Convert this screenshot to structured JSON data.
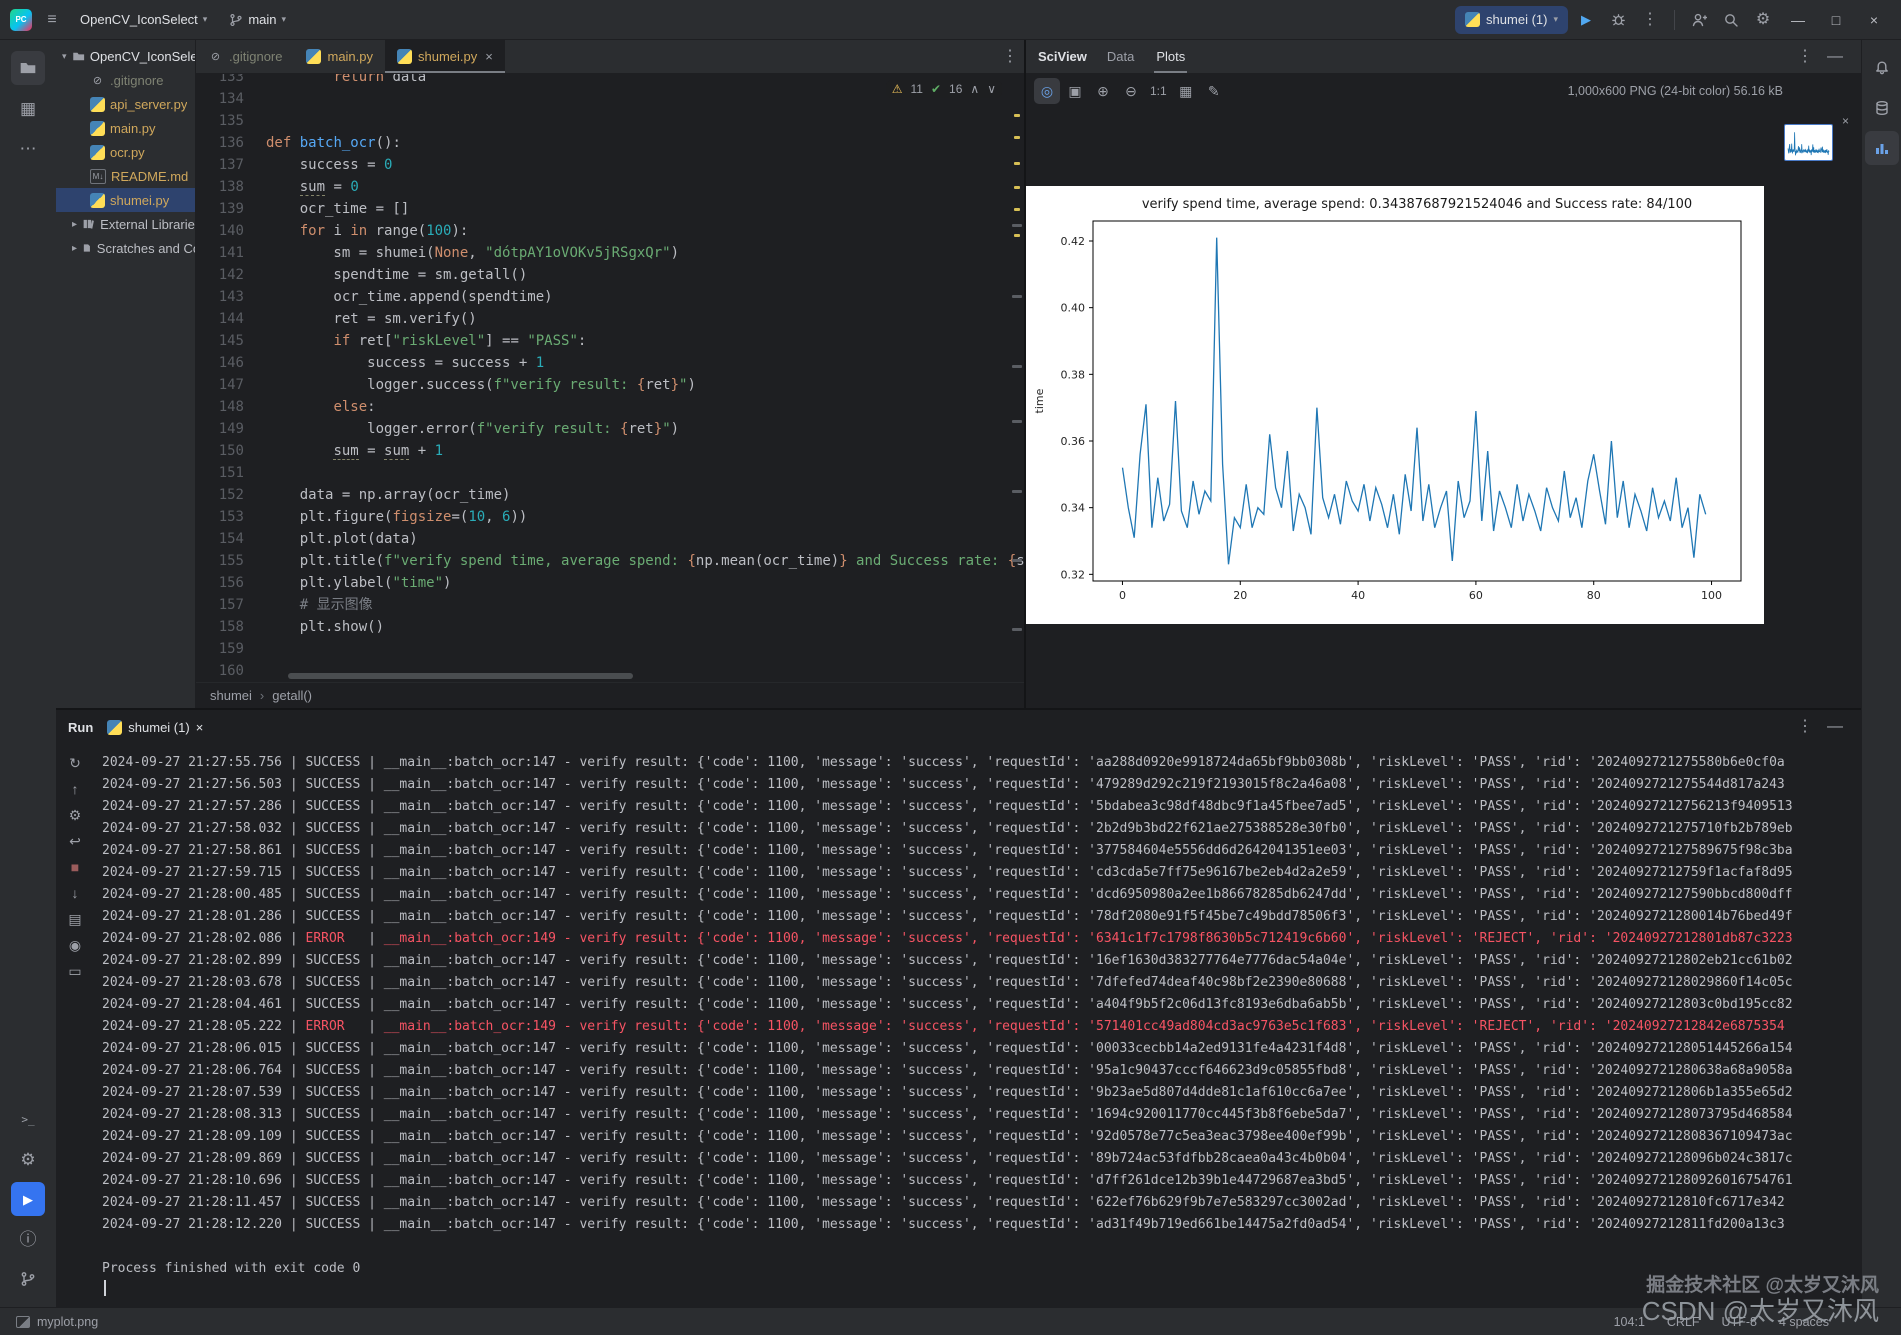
{
  "titlebar": {
    "app_logo": "PC",
    "project": "OpenCV_IconSelect",
    "branch": "main",
    "run_config": "shumei (1)",
    "window_controls": {
      "min": "—",
      "max": "□",
      "close": "×"
    }
  },
  "project": {
    "root": "OpenCV_IconSelect",
    "files": [
      {
        "icon": "ignored",
        "label": ".gitignore",
        "style": "ignored"
      },
      {
        "icon": "python",
        "label": "api_server.py",
        "style": "vcs"
      },
      {
        "icon": "python",
        "label": "main.py",
        "style": "vcs"
      },
      {
        "icon": "python",
        "label": "ocr.py",
        "style": "vcs"
      },
      {
        "icon": "markdown",
        "label": "README.md",
        "style": "vcs"
      },
      {
        "icon": "python",
        "label": "shumei.py",
        "style": "vcs",
        "selected": true
      }
    ],
    "groups": [
      {
        "label": "External Libraries"
      },
      {
        "label": "Scratches and Consoles"
      }
    ]
  },
  "editor": {
    "tabs": [
      {
        "label": ".gitignore"
      },
      {
        "label": "main.py"
      },
      {
        "label": "shumei.py",
        "close": "×"
      }
    ],
    "inspections": {
      "warnings": "11",
      "passed": "16"
    },
    "breadcrumb": [
      "shumei",
      "getall()"
    ],
    "lines": [
      {
        "no": "133",
        "t": [
          [
            "p",
            "        "
          ],
          [
            "k",
            "return"
          ],
          [
            "p",
            " data"
          ]
        ]
      },
      {
        "no": "134",
        "t": []
      },
      {
        "no": "135",
        "t": []
      },
      {
        "no": "136",
        "t": [
          [
            "k",
            "def"
          ],
          [
            "p",
            " "
          ],
          [
            "d",
            "batch_ocr"
          ],
          [
            "p",
            "():"
          ]
        ]
      },
      {
        "no": "137",
        "t": [
          [
            "p",
            "    success = "
          ],
          [
            "n",
            "0"
          ]
        ]
      },
      {
        "no": "138",
        "t": [
          [
            "p",
            "    "
          ],
          [
            "w",
            "sum"
          ],
          [
            "p",
            " = "
          ],
          [
            "n",
            "0"
          ]
        ]
      },
      {
        "no": "139",
        "t": [
          [
            "p",
            "    ocr_time = []"
          ]
        ]
      },
      {
        "no": "140",
        "t": [
          [
            "p",
            "    "
          ],
          [
            "k",
            "for"
          ],
          [
            "p",
            " i "
          ],
          [
            "k",
            "in"
          ],
          [
            "p",
            " "
          ],
          [
            "b",
            "range"
          ],
          [
            "p",
            "("
          ],
          [
            "n",
            "100"
          ],
          [
            "p",
            "):"
          ]
        ]
      },
      {
        "no": "141",
        "t": [
          [
            "p",
            "        sm = shumei("
          ],
          [
            "k",
            "None"
          ],
          [
            "p",
            ", "
          ],
          [
            "s",
            "\"dótpAY1oVOKv5jRSgxQr\""
          ],
          [
            "p",
            ")"
          ]
        ]
      },
      {
        "no": "142",
        "t": [
          [
            "p",
            "        spendtime = sm.getall()"
          ]
        ]
      },
      {
        "no": "143",
        "t": [
          [
            "p",
            "        ocr_time.append(spendtime)"
          ]
        ]
      },
      {
        "no": "144",
        "t": [
          [
            "p",
            "        ret = sm.verify()"
          ]
        ]
      },
      {
        "no": "145",
        "t": [
          [
            "p",
            "        "
          ],
          [
            "k",
            "if"
          ],
          [
            "p",
            " ret["
          ],
          [
            "s",
            "\"riskLevel\""
          ],
          [
            "p",
            "] == "
          ],
          [
            "s",
            "\"PASS\""
          ],
          [
            "p",
            ":"
          ]
        ]
      },
      {
        "no": "146",
        "t": [
          [
            "p",
            "            success = success + "
          ],
          [
            "n",
            "1"
          ]
        ]
      },
      {
        "no": "147",
        "t": [
          [
            "p",
            "            logger.success("
          ],
          [
            "s",
            "f\"verify result: "
          ],
          [
            "f",
            "{"
          ],
          [
            "p",
            "ret"
          ],
          [
            "f",
            "}"
          ],
          [
            "s",
            "\""
          ],
          [
            "p",
            ")"
          ]
        ]
      },
      {
        "no": "148",
        "t": [
          [
            "p",
            "        "
          ],
          [
            "k",
            "else"
          ],
          [
            "p",
            ":"
          ]
        ]
      },
      {
        "no": "149",
        "t": [
          [
            "p",
            "            logger.error("
          ],
          [
            "s",
            "f\"verify result: "
          ],
          [
            "f",
            "{"
          ],
          [
            "p",
            "ret"
          ],
          [
            "f",
            "}"
          ],
          [
            "s",
            "\""
          ],
          [
            "p",
            ")"
          ]
        ]
      },
      {
        "no": "150",
        "t": [
          [
            "p",
            "        "
          ],
          [
            "w",
            "sum"
          ],
          [
            "p",
            " = "
          ],
          [
            "w",
            "sum"
          ],
          [
            "p",
            " + "
          ],
          [
            "n",
            "1"
          ]
        ]
      },
      {
        "no": "151",
        "t": []
      },
      {
        "no": "152",
        "t": [
          [
            "p",
            "    data = np.array(ocr_time)"
          ]
        ]
      },
      {
        "no": "153",
        "t": [
          [
            "p",
            "    plt.figure("
          ],
          [
            "a",
            "figsize"
          ],
          [
            "p",
            "=("
          ],
          [
            "n",
            "10"
          ],
          [
            "p",
            ", "
          ],
          [
            "n",
            "6"
          ],
          [
            "p",
            "))"
          ]
        ]
      },
      {
        "no": "154",
        "t": [
          [
            "p",
            "    plt.plot(data)"
          ]
        ]
      },
      {
        "no": "155",
        "t": [
          [
            "p",
            "    plt.title("
          ],
          [
            "s",
            "f\"verify spend time, average spend: "
          ],
          [
            "f",
            "{"
          ],
          [
            "p",
            "np.mean(ocr_time)"
          ],
          [
            "f",
            "}"
          ],
          [
            "s",
            " and Success rate: "
          ],
          [
            "f",
            "{"
          ],
          [
            "p",
            "str(s"
          ]
        ]
      },
      {
        "no": "156",
        "t": [
          [
            "p",
            "    plt.ylabel("
          ],
          [
            "s",
            "\"time\""
          ],
          [
            "p",
            ")"
          ]
        ]
      },
      {
        "no": "157",
        "t": [
          [
            "p",
            "    "
          ],
          [
            "c",
            "# 显示图像"
          ]
        ]
      },
      {
        "no": "158",
        "t": [
          [
            "p",
            "    plt.show()"
          ]
        ]
      },
      {
        "no": "159",
        "t": []
      },
      {
        "no": "160",
        "t": []
      }
    ]
  },
  "sciview": {
    "title": "SciView",
    "tabs": [
      "Data",
      "Plots"
    ],
    "active_tab": "Plots",
    "zoom_label": "1:1",
    "meta": "1,000x600 PNG (24-bit color) 56.16 kB"
  },
  "chart_data": {
    "type": "line",
    "title": "verify spend time, average spend: 0.34387687921524046 and Success rate: 84/100",
    "xlabel": "",
    "ylabel": "time",
    "x_ticks": [
      0,
      20,
      40,
      60,
      80,
      100
    ],
    "y_ticks": [
      0.32,
      0.34,
      0.36,
      0.38,
      0.4,
      0.42
    ],
    "y_tick_labels": [
      "0.32",
      "0.34",
      "0.36",
      "0.38",
      "0.40",
      "0.42"
    ],
    "xlim": [
      -5,
      105
    ],
    "ylim": [
      0.318,
      0.426
    ],
    "grid": false,
    "legend": "none",
    "line_color": "#1f77b4",
    "values": [
      0.352,
      0.34,
      0.331,
      0.356,
      0.371,
      0.334,
      0.349,
      0.336,
      0.341,
      0.372,
      0.339,
      0.334,
      0.348,
      0.338,
      0.345,
      0.342,
      0.421,
      0.353,
      0.323,
      0.337,
      0.334,
      0.347,
      0.334,
      0.34,
      0.338,
      0.362,
      0.346,
      0.34,
      0.357,
      0.333,
      0.344,
      0.34,
      0.332,
      0.37,
      0.343,
      0.337,
      0.344,
      0.335,
      0.348,
      0.342,
      0.339,
      0.347,
      0.336,
      0.346,
      0.341,
      0.334,
      0.344,
      0.332,
      0.35,
      0.339,
      0.364,
      0.336,
      0.347,
      0.334,
      0.34,
      0.345,
      0.324,
      0.348,
      0.337,
      0.342,
      0.369,
      0.336,
      0.357,
      0.333,
      0.345,
      0.34,
      0.334,
      0.347,
      0.336,
      0.344,
      0.339,
      0.333,
      0.346,
      0.34,
      0.336,
      0.351,
      0.337,
      0.343,
      0.334,
      0.348,
      0.356,
      0.345,
      0.335,
      0.36,
      0.337,
      0.348,
      0.334,
      0.344,
      0.339,
      0.333,
      0.346,
      0.337,
      0.342,
      0.336,
      0.349,
      0.334,
      0.34,
      0.325,
      0.344,
      0.338
    ]
  },
  "run": {
    "title": "Run",
    "tab": "shumei (1)",
    "tab_close": "×",
    "sep": " | ",
    "module": "__main__:batch_ocr:",
    "msg_p1": " - verify result: {'code': 1100, 'message': 'success', 'requestId': '",
    "msg_p2": "', 'riskLevel': '",
    "msg_p3": "', 'rid': '",
    "exit_text": "Process finished with exit code 0",
    "rows": [
      {
        "time": "2024-09-27 21:27:55.756",
        "level": "SUCCESS",
        "line": "147",
        "requestId": "aa288d0920e9918724da65bf9bb0308b",
        "riskLevel": "PASS",
        "rid": "2024092721275580b6e0cf0a"
      },
      {
        "time": "2024-09-27 21:27:56.503",
        "level": "SUCCESS",
        "line": "147",
        "requestId": "479289d292c219f2193015f8c2a46a08",
        "riskLevel": "PASS",
        "rid": "2024092721275544d817a243"
      },
      {
        "time": "2024-09-27 21:27:57.286",
        "level": "SUCCESS",
        "line": "147",
        "requestId": "5bdabea3c98df48dbc9f1a45fbee7ad5",
        "riskLevel": "PASS",
        "rid": "20240927212756213f9409513"
      },
      {
        "time": "2024-09-27 21:27:58.032",
        "level": "SUCCESS",
        "line": "147",
        "requestId": "2b2d9b3bd22f621ae275388528e30fb0",
        "riskLevel": "PASS",
        "rid": "2024092721275710fb2b789eb"
      },
      {
        "time": "2024-09-27 21:27:58.861",
        "level": "SUCCESS",
        "line": "147",
        "requestId": "377584604e5556dd6d2642041351ee03",
        "riskLevel": "PASS",
        "rid": "202409272127589675f98c3ba"
      },
      {
        "time": "2024-09-27 21:27:59.715",
        "level": "SUCCESS",
        "line": "147",
        "requestId": "cd3cda5e7ff75e96167be2eb4d2a2e59",
        "riskLevel": "PASS",
        "rid": "20240927212759f1acfaf8d95"
      },
      {
        "time": "2024-09-27 21:28:00.485",
        "level": "SUCCESS",
        "line": "147",
        "requestId": "dcd6950980a2ee1b86678285db6247dd",
        "riskLevel": "PASS",
        "rid": "202409272127590bbcd800dff"
      },
      {
        "time": "2024-09-27 21:28:01.286",
        "level": "SUCCESS",
        "line": "147",
        "requestId": "78df2080e91f5f45be7c49bdd78506f3",
        "riskLevel": "PASS",
        "rid": "2024092721280014b76bed49f"
      },
      {
        "time": "2024-09-27 21:28:02.086",
        "level": "ERROR",
        "line": "149",
        "requestId": "6341c1f7c1798f8630b5c712419c6b60",
        "riskLevel": "REJECT",
        "rid": "20240927212801db87c3223"
      },
      {
        "time": "2024-09-27 21:28:02.899",
        "level": "SUCCESS",
        "line": "147",
        "requestId": "16ef1630d383277764e7776dac54a04e",
        "riskLevel": "PASS",
        "rid": "20240927212802eb21cc61b02"
      },
      {
        "time": "2024-09-27 21:28:03.678",
        "level": "SUCCESS",
        "line": "147",
        "requestId": "7dfefed74deaf40c98bf2e2390e80688",
        "riskLevel": "PASS",
        "rid": "202409272128029860f14c05c"
      },
      {
        "time": "2024-09-27 21:28:04.461",
        "level": "SUCCESS",
        "line": "147",
        "requestId": "a404f9b5f2c06d13fc8193e6dba6ab5b",
        "riskLevel": "PASS",
        "rid": "20240927212803c0bd195cc82"
      },
      {
        "time": "2024-09-27 21:28:05.222",
        "level": "ERROR",
        "line": "149",
        "requestId": "571401cc49ad804cd3ac9763e5c1f683",
        "riskLevel": "REJECT",
        "rid": "20240927212842e6875354"
      },
      {
        "time": "2024-09-27 21:28:06.015",
        "level": "SUCCESS",
        "line": "147",
        "requestId": "00033cecbb14a2ed9131fe4a4231f4d8",
        "riskLevel": "PASS",
        "rid": "202409272128051445266a154"
      },
      {
        "time": "2024-09-27 21:28:06.764",
        "level": "SUCCESS",
        "line": "147",
        "requestId": "95a1c90437cccf646623d9c05855fbd8",
        "riskLevel": "PASS",
        "rid": "2024092721280638a68a9058a"
      },
      {
        "time": "2024-09-27 21:28:07.539",
        "level": "SUCCESS",
        "line": "147",
        "requestId": "9b23ae5d807d4dde81c1af610cc6a7ee",
        "riskLevel": "PASS",
        "rid": "20240927212806b1a355e65d2"
      },
      {
        "time": "2024-09-27 21:28:08.313",
        "level": "SUCCESS",
        "line": "147",
        "requestId": "1694c920011770cc445f3b8f6ebe5da7",
        "riskLevel": "PASS",
        "rid": "202409272128073795d468584"
      },
      {
        "time": "2024-09-27 21:28:09.109",
        "level": "SUCCESS",
        "line": "147",
        "requestId": "92d0578e77c5ea3eac3798ee400ef99b",
        "riskLevel": "PASS",
        "rid": "20240927212808367109473ac"
      },
      {
        "time": "2024-09-27 21:28:09.869",
        "level": "SUCCESS",
        "line": "147",
        "requestId": "89b724ac53fdfbb28caea0a43c4b0b04",
        "riskLevel": "PASS",
        "rid": "202409272128096b024c3817c"
      },
      {
        "time": "2024-09-27 21:28:10.696",
        "level": "SUCCESS",
        "line": "147",
        "requestId": "d7ff261dce12b39b1e44729687ea3bd5",
        "riskLevel": "PASS",
        "rid": "2024092721280926016754761"
      },
      {
        "time": "2024-09-27 21:28:11.457",
        "level": "SUCCESS",
        "line": "147",
        "requestId": "622ef76b629f9b7e7e583297cc3002ad",
        "riskLevel": "PASS",
        "rid": "20240927212810fc6717e342"
      },
      {
        "time": "2024-09-27 21:28:12.220",
        "level": "SUCCESS",
        "line": "147",
        "requestId": "ad31f49b719ed661be14475a2fd0ad54",
        "riskLevel": "PASS",
        "rid": "20240927212811fd200a13c3"
      }
    ]
  },
  "status_bar": {
    "left": "myplot.png",
    "items": [
      "104:1",
      "CRLF",
      "UTF-8",
      "4 spaces"
    ]
  },
  "watermark": {
    "line1": "掘金技术社区 @太岁又沐风",
    "line2": "CSDN @太岁又沐风"
  }
}
